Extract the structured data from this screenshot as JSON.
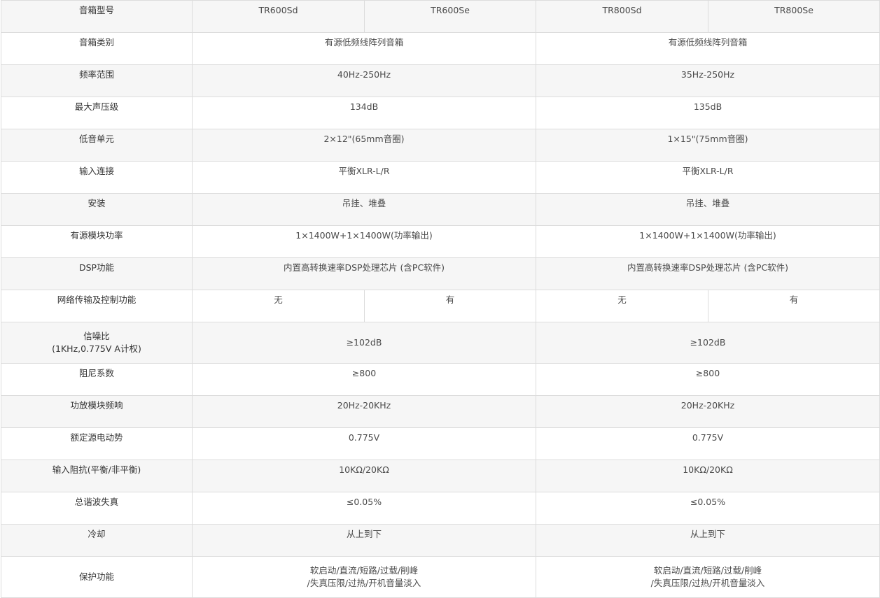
{
  "header": {
    "label": "音箱型号",
    "models": [
      "TR600Sd",
      "TR600Se",
      "TR800Sd",
      "TR800Se"
    ]
  },
  "rows": {
    "type": {
      "label": "音箱类别",
      "tr600": "有源低频线阵列音箱",
      "tr800": "有源低频线阵列音箱"
    },
    "freq": {
      "label": "频率范围",
      "tr600": "40Hz-250Hz",
      "tr800": "35Hz-250Hz"
    },
    "spl": {
      "label": "最大声压级",
      "tr600": "134dB",
      "tr800": "135dB"
    },
    "woofer": {
      "label": "低音单元",
      "tr600": "2×12\"(65mm音圈)",
      "tr800": "1×15\"(75mm音圈)"
    },
    "input": {
      "label": "输入连接",
      "tr600": "平衡XLR-L/R",
      "tr800": "平衡XLR-L/R"
    },
    "mount": {
      "label": "安装",
      "tr600": "吊挂、堆叠",
      "tr800": "吊挂、堆叠"
    },
    "power": {
      "label": "有源模块功率",
      "tr600": "1×1400W+1×1400W(功率输出)",
      "tr800": "1×1400W+1×1400W(功率输出)"
    },
    "dsp": {
      "label": "DSP功能",
      "tr600": "内置高转换速率DSP处理芯片 (含PC软件)",
      "tr800": "内置高转换速率DSP处理芯片 (含PC软件)"
    },
    "network": {
      "label": "网络传输及控制功能",
      "values": [
        "无",
        "有",
        "无",
        "有"
      ]
    },
    "snr": {
      "label_line1": "信噪比",
      "label_line2": "(1KHz,0.775V A计权)",
      "tr600": "≥102dB",
      "tr800": "≥102dB"
    },
    "damping": {
      "label": "阻尼系数",
      "tr600": "≥800",
      "tr800": "≥800"
    },
    "amp_freq": {
      "label": "功放模块频响",
      "tr600": "20Hz-20KHz",
      "tr800": "20Hz-20KHz"
    },
    "emf": {
      "label": "额定源电动势",
      "tr600": "0.775V",
      "tr800": "0.775V"
    },
    "impedance": {
      "label": "输入阻抗(平衡/非平衡)",
      "tr600": "10KΩ/20KΩ",
      "tr800": "10KΩ/20KΩ"
    },
    "thd": {
      "label": "总谐波失真",
      "tr600": "≤0.05%",
      "tr800": "≤0.05%"
    },
    "cooling": {
      "label": "冷却",
      "tr600": "从上到下",
      "tr800": "从上到下"
    },
    "protection": {
      "label": "保护功能",
      "tr600_line1": "软启动/直流/短路/过载/削峰",
      "tr600_line2": "/失真压限/过热/开机音量淡入",
      "tr800_line1": "软启动/直流/短路/过载/削峰",
      "tr800_line2": "/失真压限/过热/开机音量淡入"
    }
  }
}
